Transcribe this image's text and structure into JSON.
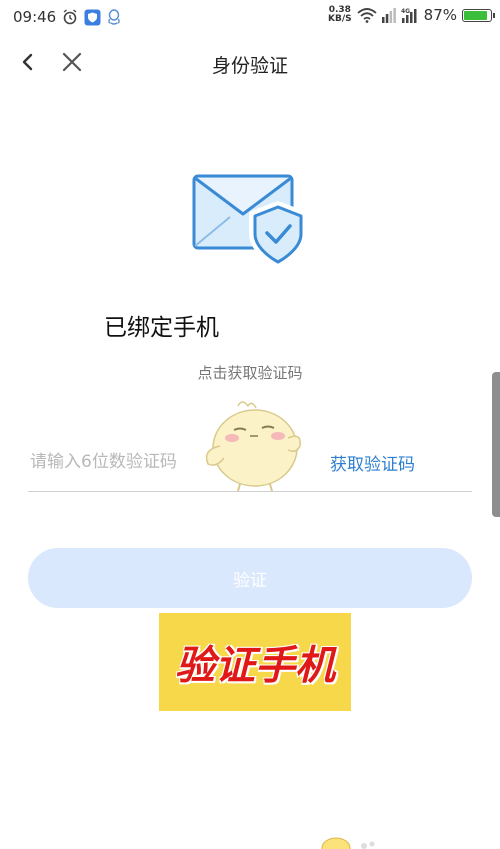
{
  "status_bar": {
    "time": "09:46",
    "speed_value": "0.38",
    "speed_unit": "KB/S",
    "network": "4G",
    "battery": "87%",
    "battery_level": 0.87,
    "icons": [
      "alarm-icon",
      "shield-app-icon",
      "qq-icon",
      "wifi-icon",
      "signal-icon",
      "signal-4g-icon",
      "battery-icon"
    ]
  },
  "nav": {
    "title": "身份验证",
    "back_icon": "chevron-left-icon",
    "close_icon": "close-icon"
  },
  "content": {
    "title": "已绑定手机",
    "hint": "点击获取验证码",
    "code_placeholder": "请输入6位数验证码",
    "get_code_label": "获取验证码",
    "verify_label": "验证"
  },
  "banner": {
    "text": "验证手机"
  },
  "colors": {
    "accent": "#2f7fd0",
    "button_disabled": "#d9e8fc",
    "banner_bg": "#f6d84a",
    "banner_text": "#e01818",
    "envelope_fill": "#d8ecfb",
    "envelope_stroke": "#3a8ad6"
  }
}
